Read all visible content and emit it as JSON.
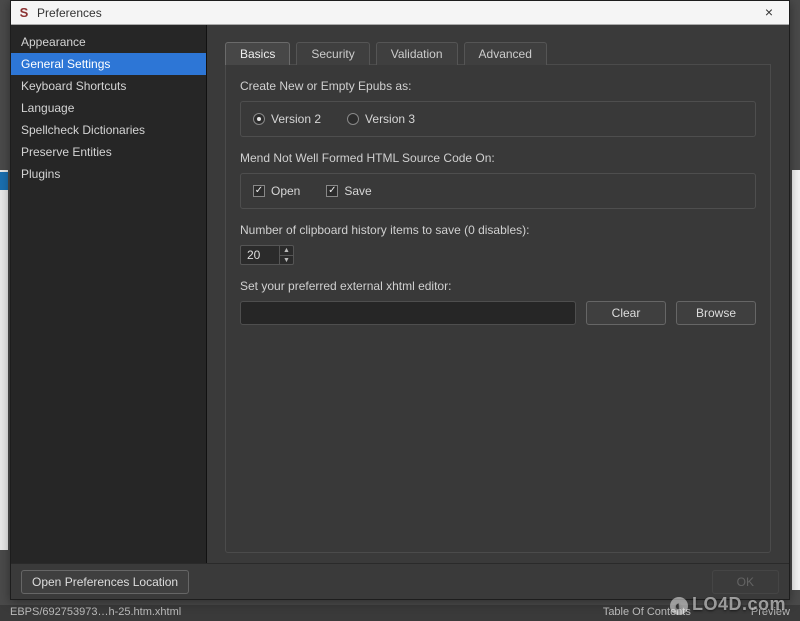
{
  "window": {
    "title": "Preferences"
  },
  "sidebar": {
    "items": [
      {
        "label": "Appearance"
      },
      {
        "label": "General Settings",
        "selected": true
      },
      {
        "label": "Keyboard Shortcuts"
      },
      {
        "label": "Language"
      },
      {
        "label": "Spellcheck Dictionaries"
      },
      {
        "label": "Preserve Entities"
      },
      {
        "label": "Plugins"
      }
    ]
  },
  "tabs": {
    "items": [
      {
        "label": "Basics",
        "active": true
      },
      {
        "label": "Security"
      },
      {
        "label": "Validation"
      },
      {
        "label": "Advanced"
      }
    ]
  },
  "basics": {
    "create_label": "Create New or Empty Epubs as:",
    "version2": "Version 2",
    "version3": "Version 3",
    "version_selected": "2",
    "mend_label": "Mend Not Well Formed HTML Source Code On:",
    "open_label": "Open",
    "save_label": "Save",
    "open_checked": true,
    "save_checked": true,
    "clipboard_label": "Number of clipboard history items to save (0 disables):",
    "clipboard_value": "20",
    "editor_label": "Set your preferred external xhtml editor:",
    "editor_path": "",
    "clear_label": "Clear",
    "browse_label": "Browse"
  },
  "footer": {
    "open_location": "Open Preferences Location",
    "ok": "OK"
  },
  "backdrop": {
    "path_fragment": "EBPS/692753973…h-25.htm.xhtml",
    "toc": "Table Of Contents",
    "preview": "Preview"
  },
  "watermark": "LO4D.com"
}
